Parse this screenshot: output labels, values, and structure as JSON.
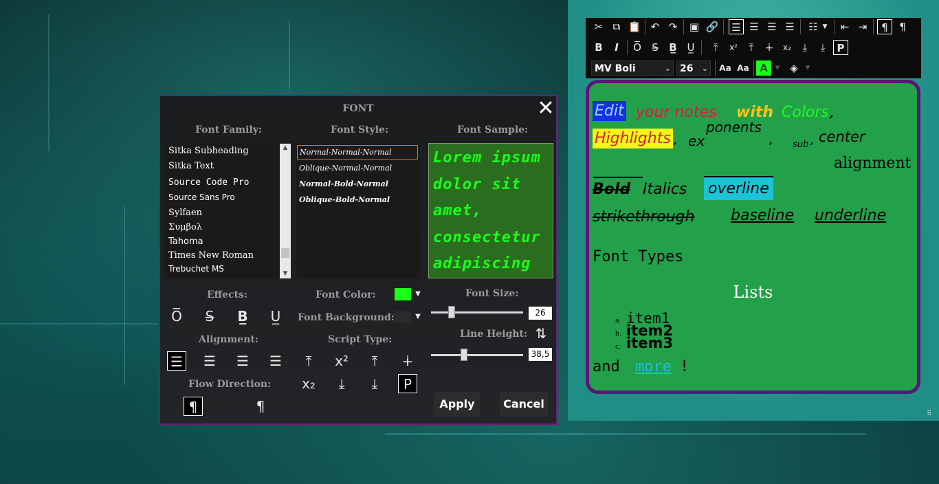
{
  "dialog": {
    "title": "FONT",
    "close_icon": "close-icon",
    "family_label": "Font Family:",
    "style_label": "Font Style:",
    "sample_label": "Font Sample:",
    "families": [
      "Sitka Subheading",
      "Sitka Text",
      "Source Code Pro",
      "Source Sans Pro",
      "Sylfaen",
      "Συμβολ",
      "Tahoma",
      "Times New Roman",
      "Trebuchet MS"
    ],
    "styles": [
      "Normal-Normal-Normal",
      "Oblique-Normal-Normal",
      "Normal-Bold-Normal",
      "Oblique-Bold-Normal"
    ],
    "sample_text": "Lorem ipsum dolor sit amet, consectetur adipiscing",
    "effects_label": "Effects:",
    "alignment_label": "Alignment:",
    "flow_label": "Flow Direction:",
    "font_color_label": "Font Color:",
    "font_bg_label": "Font Background:",
    "script_label": "Script Type:",
    "font_size_label": "Font Size:",
    "font_size_value": "26",
    "line_height_label": "Line Height:",
    "line_height_value": "38,5",
    "font_size_level": 0.2,
    "line_height_level": 0.35,
    "apply": "Apply",
    "cancel": "Cancel",
    "colors": {
      "font_color": "#1aff1a",
      "border": "#6a1f7a",
      "sample_bg": "#2b6d1f"
    }
  },
  "editor": {
    "font_name": "MV Boli",
    "font_size": "26",
    "note": {
      "edit": "Edit",
      "your_notes": "your notes",
      "with": "with",
      "colors": "Colors",
      "comma": ",",
      "highlights": "Highlights",
      "ex": "ex",
      "ponents": "ponents",
      "sub": "sub",
      "center": "center",
      "alignment": "alignment",
      "bold": "Bold",
      "italics": "Italics",
      "overline": "overline",
      "strikethrough": "strikethrough",
      "baseline": "baseline",
      "underline": "underline",
      "font_types": "Font Types",
      "lists": "Lists",
      "items": [
        {
          "marker": "a.",
          "text": "item1"
        },
        {
          "marker": "b.",
          "text": "item2"
        },
        {
          "marker": "c.",
          "text": "item3"
        }
      ],
      "and": "and",
      "more": "more",
      "excl": "!"
    },
    "colors": {
      "note_bg": "#23a04a",
      "note_border": "#5b1477",
      "edit_hl": "#1530e0",
      "highlights_hl": "#f5f51a",
      "overline_hl": "#1ac3d6"
    }
  }
}
